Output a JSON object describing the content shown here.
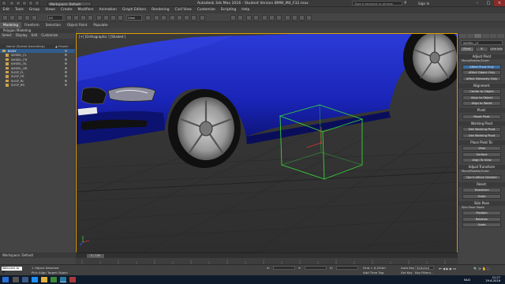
{
  "titlebar": {
    "title": "Autodesk 3ds Max 2016  -  Student Version   BMW_M4_F32.max",
    "workspace": "Workspace: Default",
    "search_placeholder": "Type a keyword or phrase",
    "signin": "Sign In"
  },
  "menubar": [
    "Edit",
    "Tools",
    "Group",
    "Views",
    "Create",
    "Modifiers",
    "Animation",
    "Graph Editors",
    "Rendering",
    "Civil View",
    "Customize",
    "Scripting",
    "Help"
  ],
  "toolbar": {
    "selection_filter": "All",
    "view_dropdown": "View"
  },
  "ribbon": {
    "tabs": [
      "Modeling",
      "Freeform",
      "Selection",
      "Object Paint",
      "Populate"
    ],
    "active_tab": "Modeling",
    "subtitle": "Polygon Modeling"
  },
  "explorer": {
    "menu": [
      "Select",
      "Display",
      "Edit",
      "Customize"
    ],
    "column_header": "Name (Sorted Ascending)",
    "column_frozen": "▲ Frozen",
    "items": [
      "BODY",
      "WHEEL_FL",
      "WHEEL_FR",
      "WHEEL_RL",
      "WHEEL_RR",
      "SUSP_FL",
      "SUSP_FR",
      "SUSP_RL",
      "SUSP_RR"
    ]
  },
  "viewport": {
    "label": "[+] [Orthographic ] [Shaded ]"
  },
  "command_panel": {
    "object_name": "WHEEL_LF",
    "tabs": [
      "Pivot",
      "IK",
      "Link Info"
    ],
    "sections": [
      {
        "title": "Adjust Pivot",
        "sub": "Move/Rotate/Scale:",
        "buttons": [
          "Affect Pivot Only",
          "Affect Object Only",
          "Affect Hierarchy Only"
        ]
      },
      {
        "title": "Alignment:",
        "buttons": [
          "Center to Object",
          "Align to Object",
          "Align to World"
        ]
      },
      {
        "title": "Pivot:",
        "buttons": [
          "Reset Pivot"
        ]
      },
      {
        "title": "Working Pivot",
        "buttons": [
          "Edit Working Pivot",
          "Use Working Pivot"
        ]
      },
      {
        "title": "Place Pivot To:",
        "buttons": [
          "View",
          "Surface",
          "Align To View"
        ]
      },
      {
        "title": "Adjust Transform",
        "sub": "Move/Rotate/Scale:",
        "buttons": [
          "Don't Affect Children"
        ]
      },
      {
        "title": "Reset:",
        "buttons": [
          "Transform",
          "Scale"
        ]
      },
      {
        "title": "Skin Pose",
        "sub": "Skin Pose Mode",
        "buttons": [
          "Position",
          "Rotation",
          "Scale"
        ]
      }
    ],
    "active_button": "Affect Pivot Only"
  },
  "bottom": {
    "workspace": "Workspace: Default",
    "time_slider": "0 / 100",
    "selection_status": "1 Object Selected",
    "prompt": "Pick Align Target Object",
    "maxscript_label": "Welcome to M",
    "coords": {
      "x_label": "X:",
      "y_label": "Y:",
      "z_label": "Z:",
      "grid": "Grid = 0,254m"
    },
    "add_time_tag": "Add Time Tag",
    "auto_key": "Auto Key",
    "selected": "Selected",
    "set_key": "Set Key",
    "key_filters": "Key Filters..."
  },
  "taskbar": {
    "language": "NLD",
    "time": "21:27",
    "date": "29-6-2016"
  },
  "colors": {
    "car_body": "#1a25b8",
    "viewport_bg": "#3b3b3b",
    "selection_box": "#36d13a",
    "accent_blue": "#3b6fa6",
    "active_border": "#e0a000"
  }
}
